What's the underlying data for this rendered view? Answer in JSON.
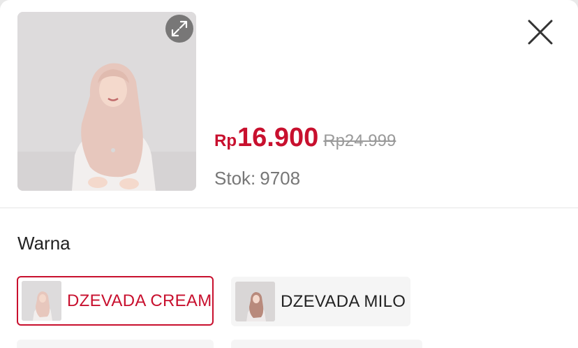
{
  "product": {
    "price_currency": "Rp",
    "price_value": "16.900",
    "original_price": "Rp24.999",
    "stock_label": "Stok:",
    "stock_value": "9708"
  },
  "variants_section": {
    "title": "Warna",
    "options": [
      {
        "label": "DZEVADA CREAM",
        "selected": true
      },
      {
        "label": "DZEVADA MILO",
        "selected": false
      }
    ]
  },
  "colors": {
    "accent": "#c8102e",
    "muted_text": "#777777",
    "strike_price": "#9a9a9a"
  },
  "icons": {
    "expand": "expand-icon",
    "close": "close-icon"
  }
}
